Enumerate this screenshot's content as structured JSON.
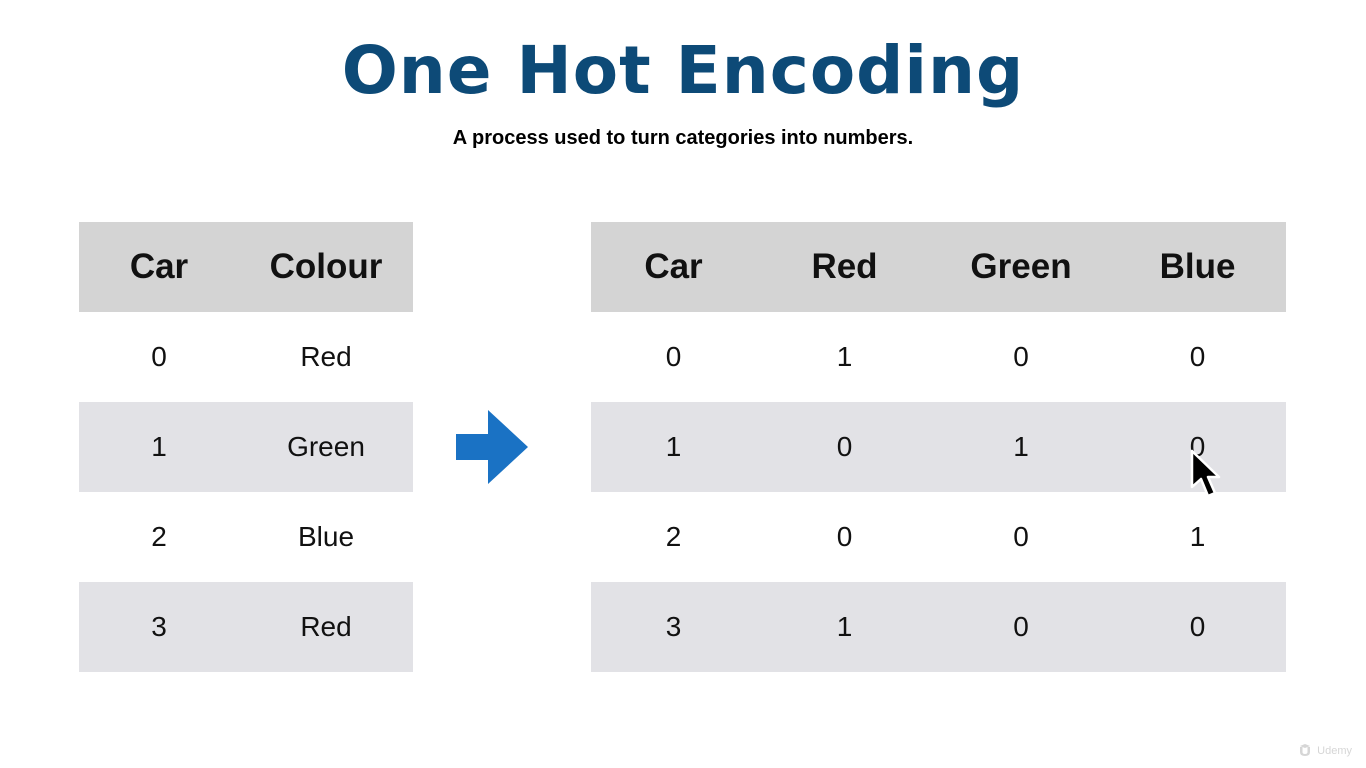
{
  "slide": {
    "title": "One Hot Encoding",
    "subtitle": "A process used to turn categories into numbers."
  },
  "colors": {
    "title": "#0d4a77",
    "header_bg": "#d4d4d4",
    "stripe_bg": "#e2e2e6",
    "arrow": "#1a72c4"
  },
  "left_table": {
    "headers": [
      "Car",
      "Colour"
    ],
    "rows": [
      [
        "0",
        "Red"
      ],
      [
        "1",
        "Green"
      ],
      [
        "2",
        "Blue"
      ],
      [
        "3",
        "Red"
      ]
    ]
  },
  "right_table": {
    "headers": [
      "Car",
      "Red",
      "Green",
      "Blue"
    ],
    "rows": [
      [
        "0",
        "1",
        "0",
        "0"
      ],
      [
        "1",
        "0",
        "1",
        "0"
      ],
      [
        "2",
        "0",
        "0",
        "1"
      ],
      [
        "3",
        "1",
        "0",
        "0"
      ]
    ]
  },
  "icons": {
    "arrow": "right-arrow-icon",
    "cursor": "mouse-pointer-icon",
    "watermark": "udemy-logo-icon"
  },
  "watermark": {
    "text": "Udemy"
  }
}
